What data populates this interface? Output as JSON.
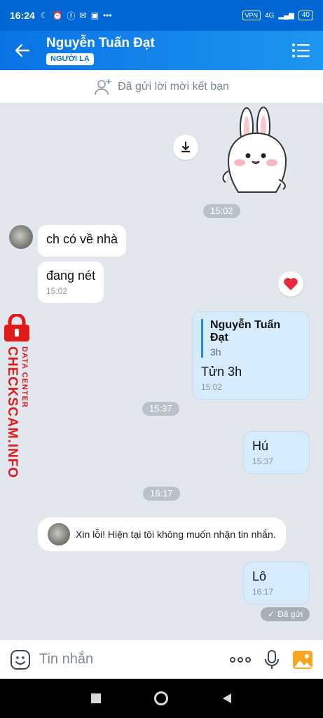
{
  "status": {
    "time": "16:24",
    "vpn": "VPN",
    "network": "4G",
    "battery": "40"
  },
  "header": {
    "title": "Nguyễn Tuấn Đạt",
    "badge": "NGƯỜI LẠ"
  },
  "friend_bar": {
    "text": "Đã gửi lời mời kết bạn"
  },
  "messages": {
    "sticker_time": "15:02",
    "in1": {
      "text": "ch có về nhà"
    },
    "in2": {
      "text": "đang nét",
      "time": "15:02"
    },
    "out1": {
      "quote_name": "Nguyễn Tuấn Đạt",
      "quote_time": "3h",
      "text": "Tửn 3h",
      "time": "15:02"
    },
    "sep2": "15:37",
    "out2": {
      "text": "Hú",
      "time": "15:37"
    },
    "sep3": "16:17",
    "system": "Xin lỗi! Hiện tại tôi không muốn nhận tin nhắn.",
    "out3": {
      "text": "Lô",
      "time": "16:17"
    },
    "sent_status": "Đã gửi"
  },
  "watermark": {
    "line1": "DATA CENTER",
    "line2": "CHECKSCAM.INFO"
  },
  "input": {
    "placeholder": "Tin nhắn"
  },
  "colors": {
    "header": "#0a73e6",
    "outgoing_bubble": "#d6ecfd",
    "chat_bg": "#e2e7ee",
    "watermark": "#e01b1b"
  }
}
